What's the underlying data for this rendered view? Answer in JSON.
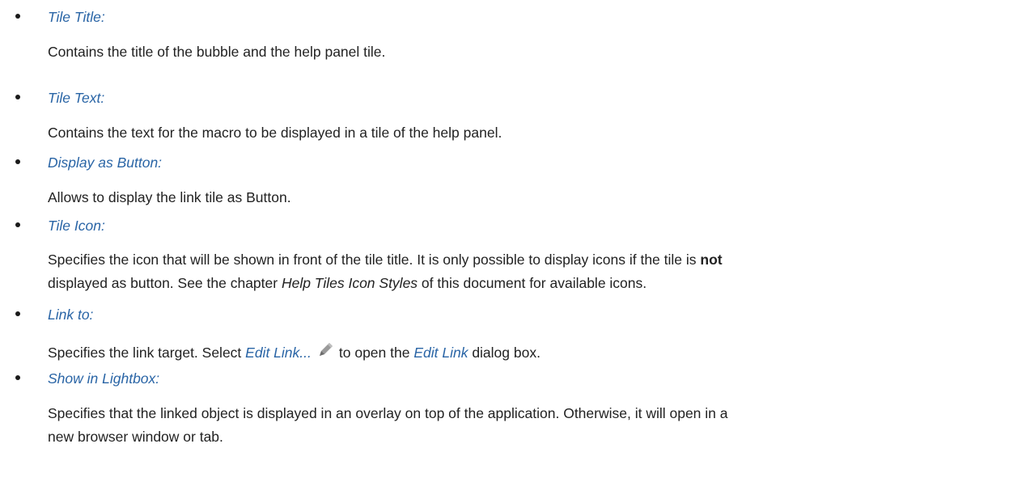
{
  "items": [
    {
      "term": "Tile Title:",
      "desc": "Contains the title of the bubble and the help panel tile."
    },
    {
      "term": "Tile Text:",
      "desc": "Contains the text for the macro to be displayed in a tile of the help panel."
    },
    {
      "term": "Display as Button:",
      "desc": "Allows to display the link tile as Button."
    },
    {
      "term": "Tile Icon:",
      "desc_line1_a": "Specifies the icon that will be shown in front of the tile title. It is only possible to display icons if the tile is ",
      "desc_line1_bold": "not",
      "desc_line2_a": "displayed as button. See the chapter ",
      "desc_line2_ref": "Help Tiles Icon Styles",
      "desc_line2_b": " of this document for available icons."
    },
    {
      "term": "Link to:",
      "desc_a": "Specifies the link target. Select ",
      "desc_link": "Edit Link...",
      "desc_icon": "pencil-icon",
      "desc_b": "to open the ",
      "desc_ref": "Edit Link",
      "desc_c": " dialog box."
    },
    {
      "term": "Show in Lightbox:",
      "desc_line1": "Specifies that the linked object is displayed in an overlay on top of the application. Otherwise, it will open in a",
      "desc_line2": "new browser window or tab."
    }
  ]
}
